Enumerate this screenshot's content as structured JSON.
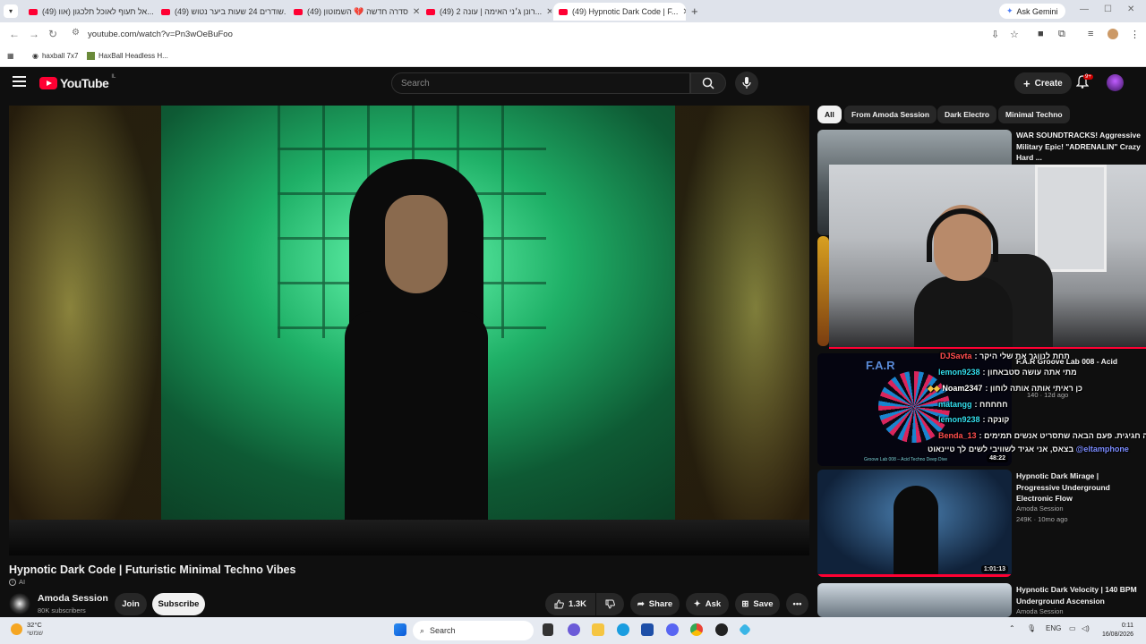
{
  "browser": {
    "tabs": [
      {
        "label": "(49) אל תעוף לאוכל תלכגון (אוו...",
        "active": false
      },
      {
        "label": "(49) שודרים 24 שעות ביער נטוש...",
        "active": false
      },
      {
        "label": "(49) סדרה חדשה 💔 השמוטון",
        "active": false
      },
      {
        "label": "(49) רונן ג׳ני האימה | עונה 2...",
        "active": false
      },
      {
        "label": "(49) Hypnotic Dark Code | F...",
        "active": true
      }
    ],
    "ask_gemini": "Ask Gemini",
    "url": "youtube.com/watch?v=Pn3wOeBuFoo",
    "bookmarks": [
      "haxball 7x7",
      "HaxBall Headless H..."
    ]
  },
  "header": {
    "logo_text": "YouTube",
    "logo_country": "IL",
    "search_placeholder": "Search",
    "create_label": "Create",
    "notifications_badge": "9+"
  },
  "video": {
    "title": "Hypnotic Dark Code | Futuristic Minimal Techno Vibes",
    "ai_label": "AI",
    "channel_name": "Amoda Session",
    "subscribers": "80K subscribers",
    "join_label": "Join",
    "subscribe_label": "Subscribe",
    "likes": "1.3K",
    "share_label": "Share",
    "ask_label": "Ask",
    "save_label": "Save"
  },
  "sidebar": {
    "chips": [
      "All",
      "From Amoda Session",
      "Dark Electro",
      "Minimal Techno"
    ],
    "recommendations": [
      {
        "title": "WAR SOUNDTRACKS! Aggressive Military Epic! \"ADRENALIN\" Crazy Hard ...",
        "channel": "",
        "meta": "",
        "duration": ""
      },
      {
        "title": "F.A.R Groove Lab 008 - Acid",
        "channel": "",
        "meta": "140 · 12d ago",
        "duration": "48:22"
      },
      {
        "title": "Hypnotic Dark Mirage | Progressive Underground Electronic Flow",
        "channel": "Amoda Session",
        "meta": "249K · 10mo ago",
        "duration": "1:01:13"
      },
      {
        "title": "Hypnotic Dark Velocity | 140 BPM Underground Ascension",
        "channel": "Amoda Session",
        "meta": "",
        "duration": ""
      }
    ],
    "far_logo": "F.A.R",
    "groove_caption": "Groove Lab 008 – Acid Techno Deep Dive"
  },
  "chat": [
    {
      "user": "DJSavta",
      "message": "תחת לנווגר את שלי היקר",
      "color": "#ff4d4d"
    },
    {
      "user": "lemon9238",
      "message": "מתי אתה עושה סטבאחון",
      "color": "#33ddee"
    },
    {
      "user": "Noam2347",
      "message": "כן ראיתי אותה אותה לוחון",
      "color": "#ffffff"
    },
    {
      "user": "matangg",
      "message": "חחחחח",
      "color": "#33ddee"
    },
    {
      "user": "lemon9238",
      "message": "קונקה",
      "color": "#33ddee"
    },
    {
      "user": "Benda_13",
      "message": "עה חגיגית. פעם הבאה שתסריט אנשים תמימים",
      "color": "#ff4d4d"
    },
    {
      "user": "@eltamphone",
      "message": "בצאס, אני אגיד לשוויבי לשים לך טיינאוט",
      "color": "#7b8cff"
    }
  ],
  "taskbar": {
    "temperature": "32°C",
    "weather_text": "שמשי",
    "search_label": "Search",
    "language": "ENG",
    "time": "0:11",
    "date": "16/08/2026"
  },
  "colors": {
    "youtube_red": "#ff0033",
    "background": "#0f0f0f",
    "chip_bg": "#272727"
  },
  "icons": [
    "menu-icon",
    "search-icon",
    "mic-icon",
    "plus-icon",
    "bell-icon",
    "like-icon",
    "dislike-icon",
    "share-icon",
    "sparkle-icon",
    "save-icon",
    "more-icon",
    "windows-start-icon"
  ]
}
